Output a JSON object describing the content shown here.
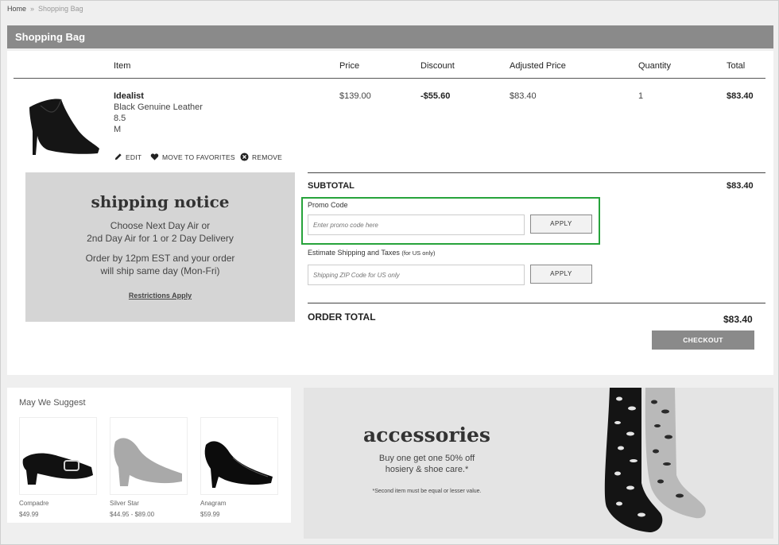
{
  "breadcrumb": {
    "home": "Home",
    "separator": "»",
    "current": "Shopping Bag"
  },
  "header": {
    "title": "Shopping Bag"
  },
  "table": {
    "columns": [
      "Item",
      "Price",
      "Discount",
      "Adjusted Price",
      "Quantity",
      "Total"
    ],
    "item": {
      "name": "Idealist",
      "color": "Black Genuine Leather",
      "size": "8.5",
      "width": "M",
      "price": "$139.00",
      "discount": "-$55.60",
      "adjusted_price": "$83.40",
      "quantity": "1",
      "total": "$83.40"
    },
    "actions": {
      "edit": "EDIT",
      "favorites": "MOVE TO FAVORITES",
      "remove": "REMOVE"
    }
  },
  "shipping_notice": {
    "title": "shipping notice",
    "line1": "Choose Next Day Air or",
    "line2": "2nd Day Air for 1 or 2 Day Delivery",
    "line3": "Order by 12pm EST and your order",
    "line4": "will ship same day (Mon-Fri)",
    "link": "Restrictions Apply"
  },
  "summary": {
    "subtotal_label": "SUBTOTAL",
    "subtotal_value": "$83.40",
    "promo_label": "Promo Code",
    "promo_placeholder": "Enter promo code here",
    "apply_label": "APPLY",
    "estimate_label": "Estimate Shipping and Taxes",
    "estimate_note": "(for US only)",
    "zip_placeholder": "Shipping ZIP Code for US only",
    "apply2_label": "APPLY",
    "order_total_label": "ORDER TOTAL",
    "order_total_value": "$83.40",
    "checkout_label": "CHECKOUT"
  },
  "suggest": {
    "title": "May We Suggest",
    "products": [
      {
        "name": "Compadre",
        "price": "$49.99"
      },
      {
        "name": "Silver Star",
        "price": "$44.95 - $89.00"
      },
      {
        "name": "Anagram",
        "price": "$59.99"
      }
    ]
  },
  "accessories": {
    "title": "accessories",
    "line1": "Buy one get one 50% off",
    "line2": "hosiery & shoe care.*",
    "note": "*Second item must be equal or lesser value."
  },
  "colors": {
    "header_bar": "#8a8a8a",
    "promo_highlight": "#27a33b",
    "shipping_box": "#d5d5d5"
  }
}
